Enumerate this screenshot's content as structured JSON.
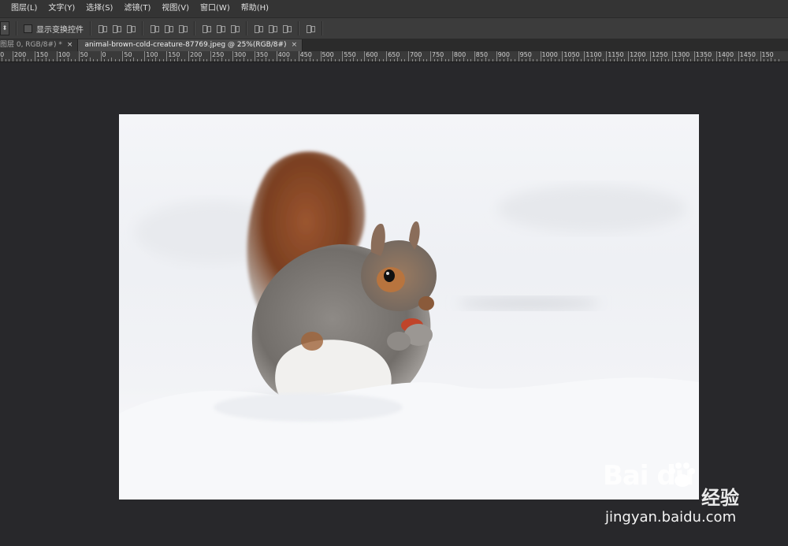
{
  "menu": [
    "图层(L)",
    "文字(Y)",
    "选择(S)",
    "滤镜(T)",
    "视图(V)",
    "窗口(W)",
    "帮助(H)"
  ],
  "options": {
    "show_transform_controls": "显示变换控件"
  },
  "tabs": [
    {
      "label": "图层 0, RGB/8#) *",
      "close": "×"
    },
    {
      "label": "animal-brown-cold-creature-87769.jpeg @ 25%(RGB/8#)",
      "close": "×"
    }
  ],
  "ruler": [
    "250",
    "200",
    "150",
    "100",
    "50",
    "0",
    "50",
    "100",
    "150",
    "200",
    "250",
    "300",
    "350",
    "400",
    "450",
    "500",
    "550",
    "600",
    "650",
    "700",
    "750",
    "800",
    "850",
    "900",
    "950",
    "1000",
    "1050",
    "1100",
    "1150",
    "1200",
    "1250",
    "1300",
    "1350",
    "1400",
    "1450",
    "150"
  ],
  "watermark": {
    "logo_text": "Bai du",
    "cn_text": "经验",
    "url": "jingyan.baidu.com"
  },
  "colors": {
    "app_bg": "#28282b",
    "menubar_bg": "#343434",
    "snow": "#f2f3f6",
    "squirrel_tail": "#8a4a25",
    "squirrel_body": "#7d7a76"
  },
  "icons": [
    "checkbox-icon",
    "align-icon",
    "close-icon",
    "paw-icon"
  ]
}
